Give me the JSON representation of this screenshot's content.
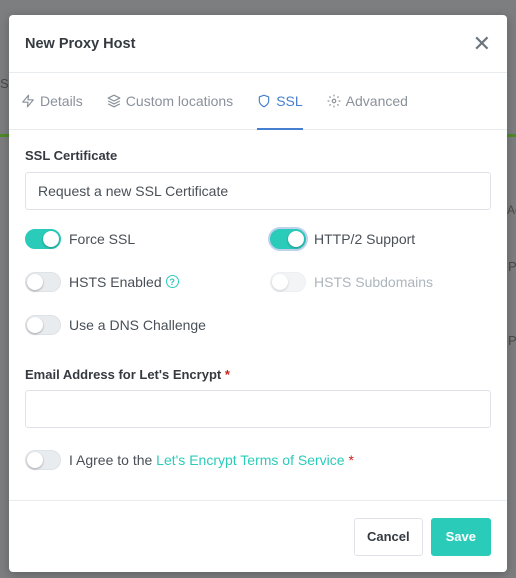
{
  "background": {
    "fragment_left": "SI",
    "fragment_right_1": "Ac",
    "fragment_right_2": "P",
    "fragment_right_3": "P"
  },
  "modal": {
    "title": "New Proxy Host",
    "close_icon": "close-icon"
  },
  "tabs": [
    {
      "label": "Details",
      "icon": "bolt-icon",
      "active": false
    },
    {
      "label": "Custom locations",
      "icon": "layers-icon",
      "active": false
    },
    {
      "label": "SSL",
      "icon": "shield-icon",
      "active": true
    },
    {
      "label": "Advanced",
      "icon": "gear-icon",
      "active": false
    }
  ],
  "ssl": {
    "certificate_label": "SSL Certificate",
    "certificate_value": "Request a new SSL Certificate",
    "toggles": {
      "force_ssl": {
        "label": "Force SSL",
        "on": true
      },
      "http2": {
        "label": "HTTP/2 Support",
        "on": true
      },
      "hsts": {
        "label": "HSTS Enabled",
        "on": false,
        "help": "?"
      },
      "hsts_subdomains": {
        "label": "HSTS Subdomains",
        "on": false,
        "disabled": true
      },
      "dns_challenge": {
        "label": "Use a DNS Challenge",
        "on": false
      }
    },
    "email_label": "Email Address for Let's Encrypt",
    "required_mark": "*",
    "email_value": "",
    "email_placeholder": "",
    "agree_prefix": "I Agree to the ",
    "agree_link": "Let's Encrypt Terms of Service",
    "agree_on": false
  },
  "footer": {
    "cancel_label": "Cancel",
    "save_label": "Save"
  },
  "colors": {
    "accent": "#2bcbba",
    "tab_active": "#467fcf",
    "required": "#cd201f"
  }
}
